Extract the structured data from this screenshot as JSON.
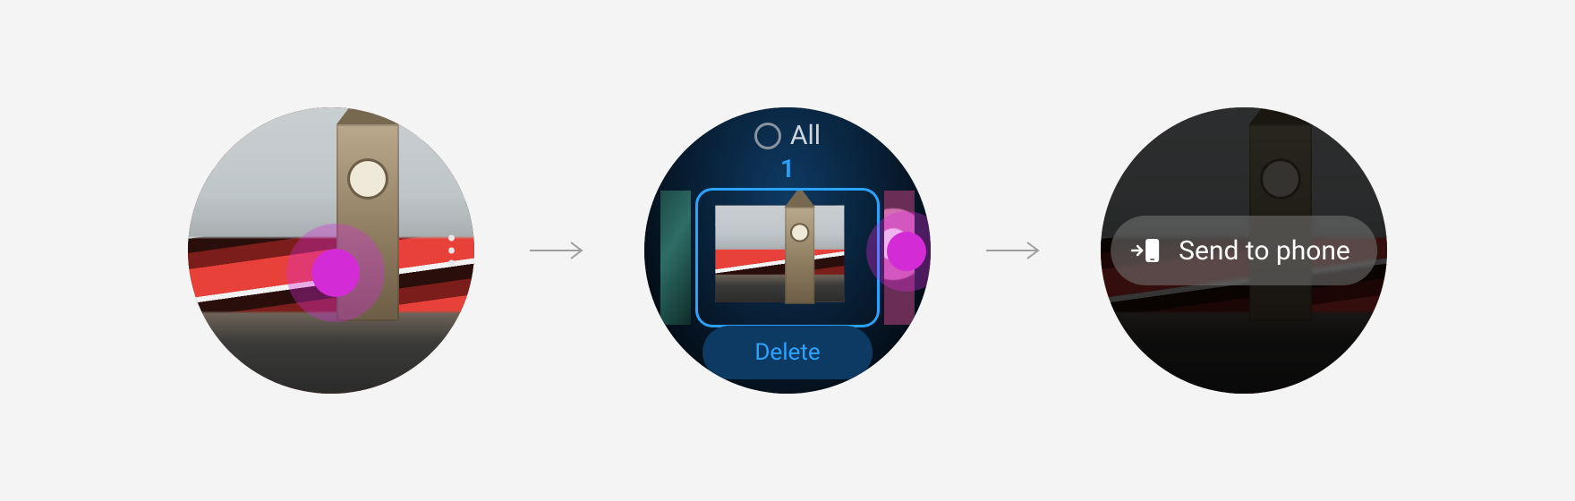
{
  "screens": {
    "photo_view": {
      "icons": {
        "more": "more-options-icon"
      },
      "touch": "long-press-highlight"
    },
    "selection": {
      "select_all_label": "All",
      "selected_count": "1",
      "delete_label": "Delete",
      "icons": {
        "select_all_ring": "select-all-icon",
        "more": "more-options-icon"
      },
      "touch": "tap-highlight"
    },
    "context_menu": {
      "send_to_phone_label": "Send to phone",
      "icons": {
        "send_to_phone": "send-to-phone-icon"
      }
    }
  },
  "flow": {
    "arrow": "arrow-right-icon"
  },
  "colors": {
    "accent_blue": "#2aa3ff",
    "panel_blue": "#0d3a63",
    "touch_magenta": "#d32bd6",
    "arrow_grey": "#9e9e9e",
    "page_bg": "#f4f4f4"
  }
}
